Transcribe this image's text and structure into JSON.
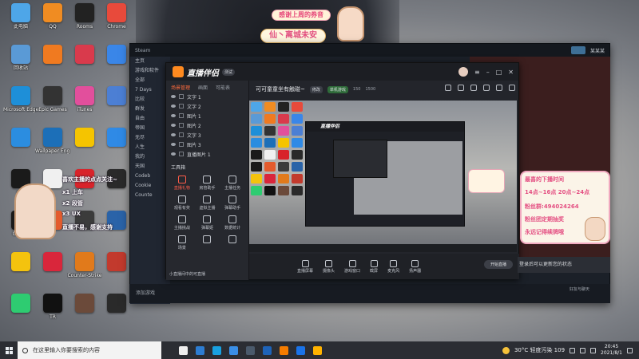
{
  "desktop": {
    "icons": [
      {
        "label": "此电脑",
        "color": "#4ea6e8"
      },
      {
        "label": "QQ",
        "color": "#f08c22"
      },
      {
        "label": "Rooms",
        "color": "#222"
      },
      {
        "label": "Chrome",
        "color": "#e84a3b"
      },
      {
        "label": "回收站",
        "color": "#5a9ad6"
      },
      {
        "label": "",
        "color": "#f07a20"
      },
      {
        "label": "",
        "color": "#d93a4c"
      },
      {
        "label": "",
        "color": "#3a86e8"
      },
      {
        "label": "Microsoft Edge",
        "color": "#1e8fd8"
      },
      {
        "label": "Epic Games",
        "color": "#333"
      },
      {
        "label": "iTunes",
        "color": "#e24f9c"
      },
      {
        "label": "",
        "color": "#4c7fd4"
      },
      {
        "label": "",
        "color": "#2b8de0"
      },
      {
        "label": "Wallpaper Engine",
        "color": "#1c6fb8"
      },
      {
        "label": "",
        "color": "#f5c400"
      },
      {
        "label": "",
        "color": "#2f8ae6"
      },
      {
        "label": "QQ",
        "color": "#1a1a1a"
      },
      {
        "label": "",
        "color": "#f0f0f0"
      },
      {
        "label": "",
        "color": "#d8232a"
      },
      {
        "label": "",
        "color": "#2a2a2a"
      },
      {
        "label": "GitHub",
        "color": "#1a1a1a"
      },
      {
        "label": "",
        "color": "#e35b2d"
      },
      {
        "label": "",
        "color": "#3b3b3b"
      },
      {
        "label": "",
        "color": "#2a63a8"
      },
      {
        "label": "",
        "color": "#f4c30e"
      },
      {
        "label": "",
        "color": "#d9263b"
      },
      {
        "label": "Counter-Strike",
        "color": "#e17a1b"
      },
      {
        "label": "",
        "color": "#c23a2d"
      },
      {
        "label": "",
        "color": "#2ecc71"
      },
      {
        "label": "TR",
        "color": "#111"
      },
      {
        "label": "",
        "color": "#6b4a3a"
      },
      {
        "label": "",
        "color": "#2a2a2a"
      }
    ]
  },
  "banner": {
    "line1": "感谢上周的券音",
    "line2": "仙丶离城未安"
  },
  "steam": {
    "title": "Steam",
    "user": "某某某",
    "sidebar": [
      "主页",
      "游戏和软件",
      "全部",
      "7 Days",
      "比较",
      "群发",
      "自由",
      "帝国",
      "无尽",
      "人生",
      "我的",
      "天国",
      "Codeb",
      "Cookie",
      "Counte"
    ],
    "footer_add": "添加游戏",
    "footer_friends": "好友与聊天"
  },
  "live": {
    "app_name": "直播伴侣",
    "version": "测试",
    "tabs": [
      "场景管理",
      "画面",
      "可能表"
    ],
    "scenes": [
      "文字 1",
      "文字 2",
      "图片 1",
      "图片 2",
      "文字 3",
      "图片 3",
      "直播图片 1"
    ],
    "tools_title": "工具箱",
    "tools": [
      "直播礼物",
      "房管助手",
      "主播任务",
      "观看有奖",
      "虚拟主播",
      "弹幕助手",
      "主播挑战",
      "弹幕姬",
      "数据统计",
      "场景",
      "",
      ""
    ],
    "note": "小直播间中的可直播",
    "room_title": "可可童童坐有触碰~",
    "chip_edit": "修改",
    "chip_area": "单机游戏",
    "stat1": "150",
    "stat2": "1500",
    "bottom": [
      "直播屏幕",
      "摄像头",
      "游戏窗口",
      "截屏",
      "麦克风",
      "扬声器"
    ],
    "start_label": "开始直播",
    "login": "登录后可以更新您的状态"
  },
  "follow_widget": {
    "lines": [
      "喜欢主播的点点关注~",
      "x1 上车",
      "x2 段管",
      "x3 UX",
      "直播不易，感谢支持"
    ]
  },
  "schedule_widget": {
    "title": "最喜的下播时间",
    "times": "14点~16点 20点~24点",
    "fans_label": "粉丝群:",
    "fans": "494024264",
    "line3": "粉丝团定期抽奖",
    "line4": "永远记得续牌哦"
  },
  "taskbar": {
    "search_placeholder": "在这里输入你要搜索的内容",
    "weather": "30°C 轻度污染 109",
    "time": "20:45",
    "date": "2021/8/1",
    "app_colors": [
      "#eee",
      "#2d7dd2",
      "#18a0e0",
      "#3a8ee6",
      "#4b5a6b",
      "#1e63b8",
      "#f57c00",
      "#1a73e8",
      "#ffb300"
    ]
  }
}
